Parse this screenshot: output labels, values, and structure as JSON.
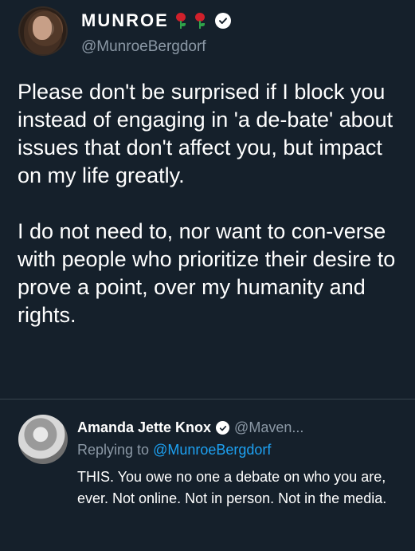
{
  "tweet": {
    "display_name": "MUNROE",
    "badges": [
      "rose-emoji",
      "rose-emoji",
      "verified-badge"
    ],
    "handle": "@MunroeBergdorf",
    "paragraph1": "Please don't be surprised if I block you instead of engaging in 'a de-bate' about issues that don't affect you, but impact on my life greatly.",
    "paragraph2": "I do not need to, nor want to con-verse with people who prioritize their desire to prove a point, over my humanity and rights."
  },
  "reply": {
    "display_name": "Amanda Jette Knox",
    "handle": "@Maven...",
    "replying_prefix": "Replying to ",
    "replying_to": "@MunroeBergdorf",
    "text": "THIS. You owe no one a debate on who you are, ever. Not online. Not in person. Not in the media."
  },
  "colors": {
    "background": "#15202b",
    "secondary_text": "#8b98a5",
    "link": "#1da1f2",
    "rose": "#d0202b"
  }
}
